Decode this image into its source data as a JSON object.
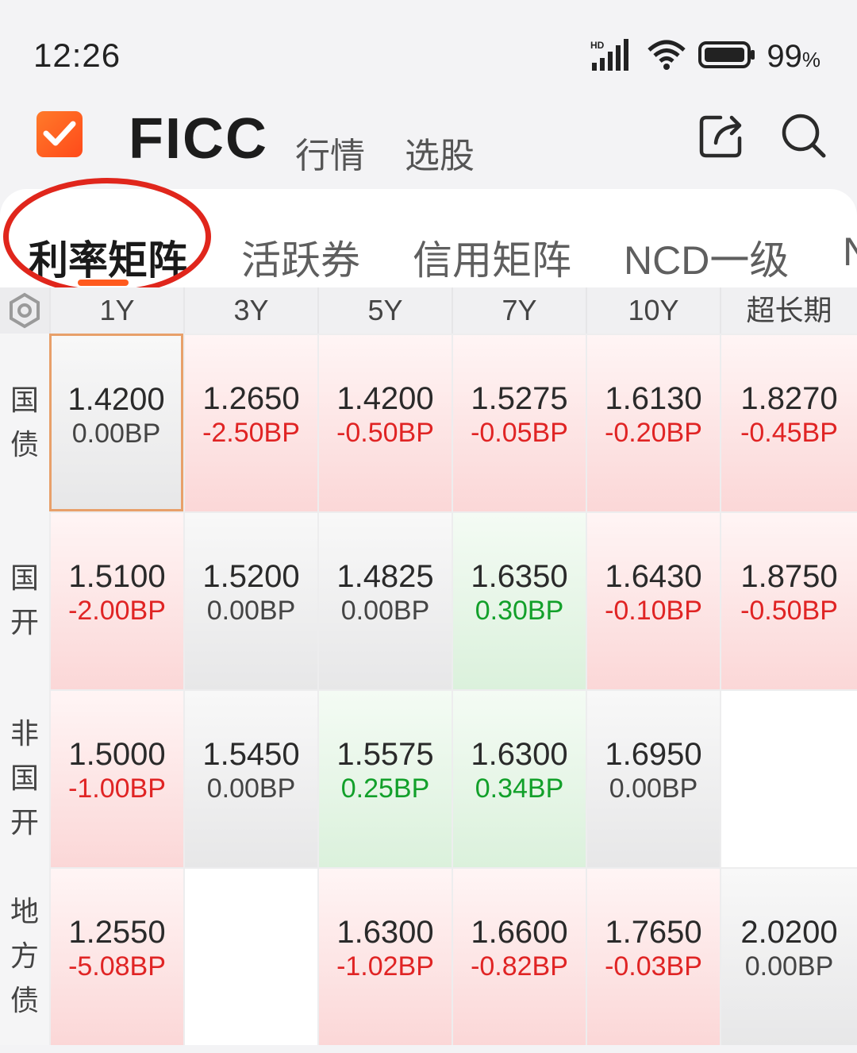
{
  "status_bar": {
    "time": "12:26",
    "network": "HD",
    "battery_value": "99",
    "battery_unit": "%"
  },
  "header": {
    "title": "FICC",
    "nav_tabs": [
      "行情",
      "选股"
    ],
    "icons": [
      "share-icon",
      "search-icon"
    ],
    "accent_color": "#ff5a1e"
  },
  "category_tabs": {
    "items": [
      "利率矩阵",
      "活跃券",
      "信用矩阵",
      "NCD一级",
      "N"
    ],
    "active_index": 0
  },
  "matrix": {
    "columns": [
      "1Y",
      "3Y",
      "5Y",
      "7Y",
      "10Y",
      "超长期"
    ],
    "rows": [
      {
        "label": [
          "国",
          "债"
        ],
        "cells": [
          {
            "value": "1.4200",
            "change": "0.00BP",
            "trend": "flat"
          },
          {
            "value": "1.2650",
            "change": "-2.50BP",
            "trend": "up"
          },
          {
            "value": "1.4200",
            "change": "-0.50BP",
            "trend": "up"
          },
          {
            "value": "1.5275",
            "change": "-0.05BP",
            "trend": "up"
          },
          {
            "value": "1.6130",
            "change": "-0.20BP",
            "trend": "up"
          },
          {
            "value": "1.8270",
            "change": "-0.45BP",
            "trend": "up"
          }
        ]
      },
      {
        "label": [
          "国",
          "开"
        ],
        "cells": [
          {
            "value": "1.5100",
            "change": "-2.00BP",
            "trend": "up"
          },
          {
            "value": "1.5200",
            "change": "0.00BP",
            "trend": "flat"
          },
          {
            "value": "1.4825",
            "change": "0.00BP",
            "trend": "flat"
          },
          {
            "value": "1.6350",
            "change": "0.30BP",
            "trend": "down"
          },
          {
            "value": "1.6430",
            "change": "-0.10BP",
            "trend": "up"
          },
          {
            "value": "1.8750",
            "change": "-0.50BP",
            "trend": "up"
          }
        ]
      },
      {
        "label": [
          "非",
          "国",
          "开"
        ],
        "cells": [
          {
            "value": "1.5000",
            "change": "-1.00BP",
            "trend": "up"
          },
          {
            "value": "1.5450",
            "change": "0.00BP",
            "trend": "flat"
          },
          {
            "value": "1.5575",
            "change": "0.25BP",
            "trend": "down"
          },
          {
            "value": "1.6300",
            "change": "0.34BP",
            "trend": "down"
          },
          {
            "value": "1.6950",
            "change": "0.00BP",
            "trend": "flat"
          },
          {
            "value": "",
            "change": "",
            "trend": "empty"
          }
        ]
      },
      {
        "label": [
          "地",
          "方",
          "债"
        ],
        "cells": [
          {
            "value": "1.2550",
            "change": "-5.08BP",
            "trend": "up"
          },
          {
            "value": "",
            "change": "",
            "trend": "empty"
          },
          {
            "value": "1.6300",
            "change": "-1.02BP",
            "trend": "up"
          },
          {
            "value": "1.6600",
            "change": "-0.82BP",
            "trend": "up"
          },
          {
            "value": "1.7650",
            "change": "-0.03BP",
            "trend": "up"
          },
          {
            "value": "2.0200",
            "change": "0.00BP",
            "trend": "flat"
          }
        ]
      }
    ],
    "colors": {
      "up": "#e02424",
      "down": "#12a02a",
      "flat": "#444444",
      "selected_border": "#e8a06a"
    }
  },
  "annotation": {
    "circle_color": "#e0261c"
  }
}
